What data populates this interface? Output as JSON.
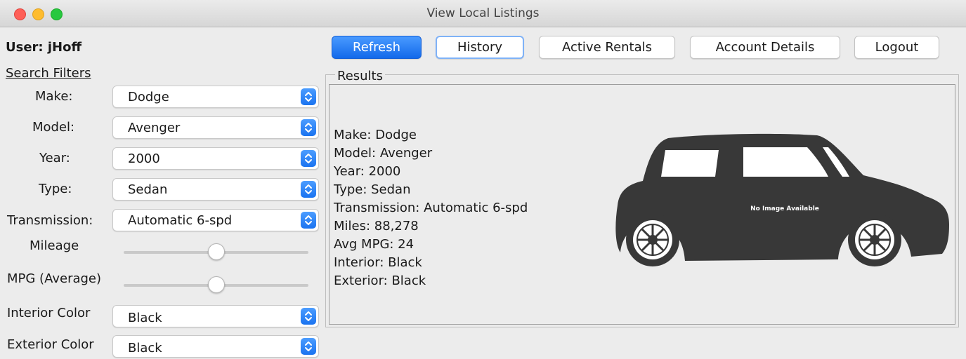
{
  "window": {
    "title": "View Local Listings"
  },
  "user": {
    "label": "User: jHoff"
  },
  "filters": {
    "heading": "Search Filters",
    "make": {
      "label": "Make:",
      "value": "Dodge"
    },
    "model": {
      "label": "Model:",
      "value": "Avenger"
    },
    "year": {
      "label": "Year:",
      "value": "2000"
    },
    "type": {
      "label": "Type:",
      "value": "Sedan"
    },
    "transmission": {
      "label": "Transmission:",
      "value": "Automatic 6-spd"
    },
    "mileage": {
      "label": "Mileage",
      "level": 0.5
    },
    "mpg": {
      "label": "MPG (Average)",
      "level": 0.5
    },
    "interior": {
      "label": "Interior Color",
      "value": "Black"
    },
    "exterior": {
      "label": "Exterior Color",
      "value": "Black"
    }
  },
  "toolbar": {
    "refresh": "Refresh",
    "history": "History",
    "active_rentals": "Active Rentals",
    "account_details": "Account Details",
    "logout": "Logout"
  },
  "results": {
    "title": "Results",
    "lines": [
      "Make: Dodge",
      "Model: Avenger",
      "Year: 2000",
      "Type: Sedan",
      "Transmission: Automatic 6-spd",
      "Miles: 88,278",
      "Avg MPG: 24",
      "Interior: Black",
      "Exterior: Black"
    ],
    "image_placeholder": "No Image Available"
  },
  "colors": {
    "accent": "#1a73f0",
    "car_silhouette": "#383838"
  }
}
